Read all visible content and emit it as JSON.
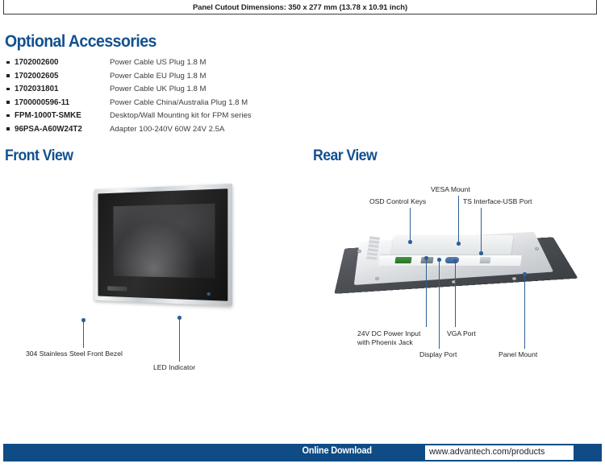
{
  "spec_box": {
    "title": "Panel Cutout Dimensions: 350 x 277 mm (13.78 x 10.91 inch)"
  },
  "sections": {
    "optional_accessories": "Optional Accessories",
    "front_view": "Front View",
    "rear_view": "Rear View"
  },
  "accessories": [
    {
      "part_number": "1702002600",
      "description": "Power Cable US Plug 1.8 M"
    },
    {
      "part_number": "1702002605",
      "description": "Power Cable EU Plug 1.8 M"
    },
    {
      "part_number": "1702031801",
      "description": "Power Cable UK Plug 1.8 M"
    },
    {
      "part_number": "1700000596-11",
      "description": "Power Cable China/Australia Plug 1.8 M"
    },
    {
      "part_number": "FPM-1000T-SMKE",
      "description": "Desktop/Wall Mounting kit for FPM series"
    },
    {
      "part_number": "96PSA-A60W24T2",
      "description": "Adapter 100-240V 60W 24V 2.5A"
    }
  ],
  "front_view_callouts": [
    {
      "label": "304 Stainless Steel Front Bezel"
    },
    {
      "label": "LED Indicator"
    }
  ],
  "rear_view_callouts": [
    {
      "label": "VESA Mount"
    },
    {
      "label": "OSD Control Keys"
    },
    {
      "label": "TS Interface-USB Port"
    },
    {
      "label_line1": "24V DC Power Input",
      "label_line2": "with Phoenix Jack"
    },
    {
      "label": "VGA Port"
    },
    {
      "label": "Display Port"
    },
    {
      "label": "Panel Mount"
    }
  ],
  "footer": {
    "label": "Online Download",
    "url": "www.advantech.com/products"
  },
  "colors": {
    "heading_blue": "#12508f",
    "footer_blue": "#0f4c86",
    "callout_blue": "#2f6093",
    "text_dark": "#231f20"
  }
}
